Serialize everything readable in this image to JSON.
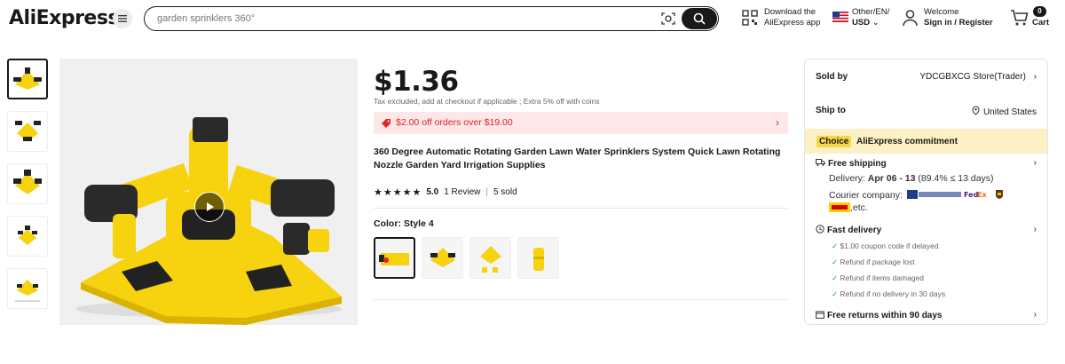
{
  "header": {
    "logo": "AliExpress",
    "search_placeholder": "garden sprinklers 360°",
    "download_line1": "Download the",
    "download_line2": "AliExpress app",
    "locale_line1": "Other/EN/",
    "locale_line2": "USD",
    "account_line1": "Welcome",
    "account_line2": "Sign in / Register",
    "cart_count": "0",
    "cart_label": "Cart"
  },
  "product": {
    "price": "$1.36",
    "tax_note": "Tax excluded, add at checkout if applicable ; Extra 5% off with coins",
    "coupon": "$2.00 off orders over $19.00",
    "title": "360 Degree Automatic Rotating Garden Lawn Water Sprinklers System Quick Lawn Rotating Nozzle Garden Yard Irrigation Supplies",
    "rating": "5.0",
    "reviews": "1 Review",
    "sold": "5 sold",
    "color_label": "Color: Style 4"
  },
  "seller": {
    "sold_by_label": "Sold by",
    "sold_by_value": "YDCGBXCG Store(Trader)",
    "ship_to_label": "Ship to",
    "ship_to_value": "United States",
    "choice_badge": "Choice",
    "commitment": "AliExpress commitment",
    "free_shipping": "Free shipping",
    "delivery_label": "Delivery:",
    "delivery_dates": "Apr 06 - 13",
    "delivery_note": "(89.4% ≤ 13 days)",
    "courier_label": "Courier company:",
    "courier_etc": ",etc.",
    "fast_delivery": "Fast delivery",
    "perks": [
      "$1.00 coupon code if delayed",
      "Refund if package lost",
      "Refund if items damaged",
      "Refund if no delivery in 30 days"
    ],
    "free_returns": "Free returns within 90 days"
  },
  "colors": {
    "accent_red": "#e0242a",
    "product_yellow": "#f7d20f",
    "choice_yellow": "#f9d648"
  }
}
